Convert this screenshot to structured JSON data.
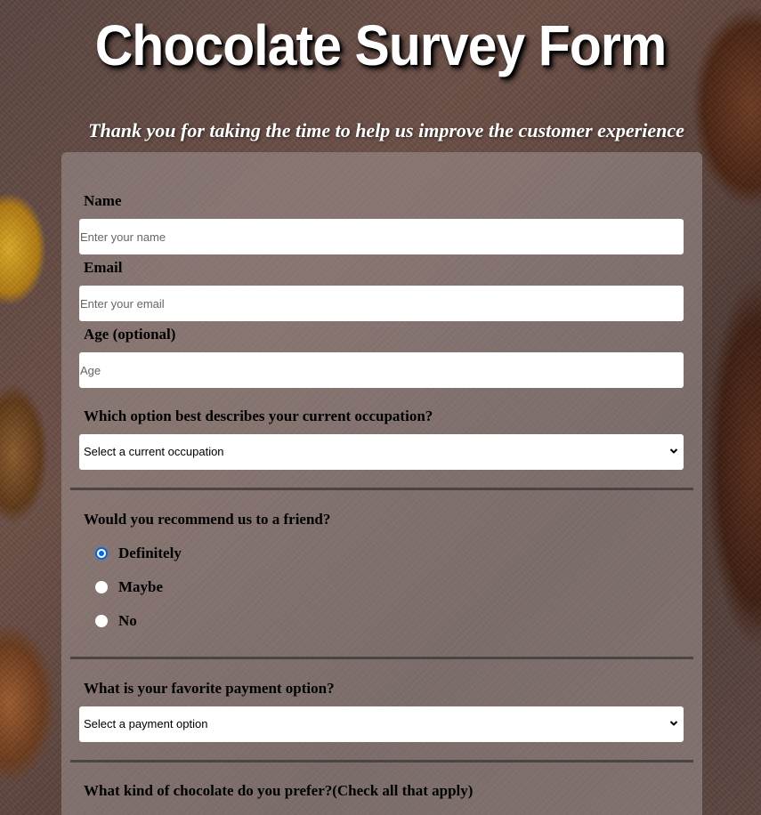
{
  "header": {
    "title": "Chocolate Survey Form",
    "subtitle": "Thank you for taking the time to help us improve the customer experience"
  },
  "form": {
    "name": {
      "label": "Name",
      "placeholder": "Enter your name",
      "value": ""
    },
    "email": {
      "label": "Email",
      "placeholder": "Enter your email",
      "value": ""
    },
    "age": {
      "label": "Age (optional)",
      "placeholder": "Age",
      "value": ""
    },
    "occupation": {
      "label": "Which option best describes your current occupation?",
      "selected": "Select a current occupation"
    },
    "recommend": {
      "label": "Would you recommend us to a friend?",
      "options": [
        "Definitely",
        "Maybe",
        "No"
      ],
      "selected": "Definitely"
    },
    "payment": {
      "label": "What is your favorite payment option?",
      "selected": "Select a payment option"
    },
    "chocolate": {
      "label": "What kind of chocolate do you prefer?(Check all that apply)"
    }
  },
  "icons": {
    "select_arrow": "chevron-down-icon"
  },
  "colors": {
    "radio_accent": "#0a66d8",
    "form_overlay": "rgba(160,150,150,0.55)",
    "divider": "#4a4444"
  }
}
